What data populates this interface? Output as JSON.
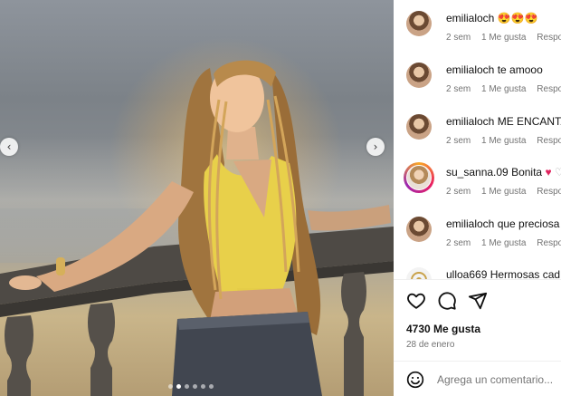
{
  "post": {
    "carousel": {
      "prev_icon": "chevron-left-icon",
      "next_icon": "chevron-right-icon",
      "dot_count": 6,
      "active_dot": 1
    },
    "comments": [
      {
        "user": "emilialoch",
        "text": "😍😍😍",
        "time": "2 sem",
        "likes": "1 Me gusta",
        "reply": "Responder"
      },
      {
        "user": "emilialoch",
        "text": "te amooo",
        "time": "2 sem",
        "likes": "1 Me gusta",
        "reply": "Responder"
      },
      {
        "user": "emilialoch",
        "text": "ME ENCANTA",
        "time": "2 sem",
        "likes": "1 Me gusta",
        "reply": "Responder"
      },
      {
        "user": "su_sanna.09",
        "text": "Bonita",
        "time": "2 sem",
        "likes": "1 Me gusta",
        "reply": "Responder"
      },
      {
        "user": "emilialoch",
        "text": "que preciosa",
        "time": "2 sem",
        "likes": "1 Me gusta",
        "reply": "Responder"
      },
      {
        "user": "ulloa669",
        "text": "Hermosas cad",
        "time": "",
        "likes": "",
        "reply": ""
      }
    ],
    "actions": {
      "like_icon": "heart-icon",
      "comment_icon": "comment-icon",
      "share_icon": "share-icon"
    },
    "likes_count": "4730 Me gusta",
    "date": "28 de enero",
    "add_comment": {
      "placeholder": "Agrega un comentario...",
      "emoji_icon": "emoji-icon"
    }
  }
}
